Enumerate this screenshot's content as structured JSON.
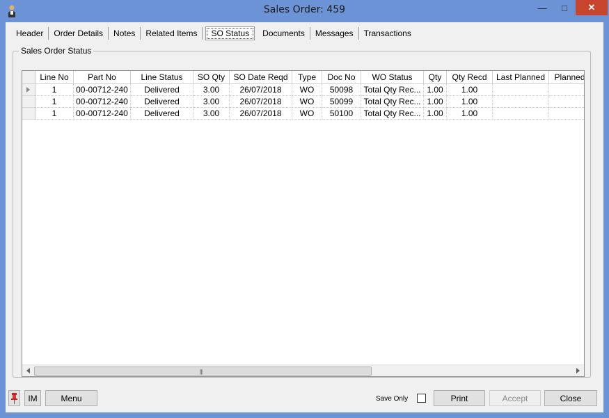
{
  "window": {
    "title": "Sales Order: 459"
  },
  "controls": {
    "minimize": "—",
    "maximize": "□",
    "close": "✕"
  },
  "tabs": [
    {
      "label": "Header"
    },
    {
      "label": "Order Details"
    },
    {
      "label": "Notes"
    },
    {
      "label": "Related Items"
    },
    {
      "label": "SO Status",
      "active": true
    },
    {
      "label": "Documents"
    },
    {
      "label": "Messages"
    },
    {
      "label": "Transactions"
    }
  ],
  "group": {
    "title": "Sales Order Status"
  },
  "grid": {
    "columns": [
      "Line No",
      "Part No",
      "Line Status",
      "SO Qty",
      "SO Date Reqd",
      "Type",
      "Doc No",
      "WO Status",
      "Qty",
      "Qty Recd",
      "Last Planned",
      "Planned"
    ],
    "rows": [
      [
        "1",
        "00-00712-240",
        "Delivered",
        "3.00",
        "26/07/2018",
        "WO",
        "50098",
        "Total Qty Rec...",
        "1.00",
        "1.00",
        "",
        ""
      ],
      [
        "1",
        "00-00712-240",
        "Delivered",
        "3.00",
        "26/07/2018",
        "WO",
        "50099",
        "Total Qty Rec...",
        "1.00",
        "1.00",
        "",
        ""
      ],
      [
        "1",
        "00-00712-240",
        "Delivered",
        "3.00",
        "26/07/2018",
        "WO",
        "50100",
        "Total Qty Rec...",
        "1.00",
        "1.00",
        "",
        ""
      ]
    ]
  },
  "footer": {
    "im_label": "IM",
    "menu_label": "Menu",
    "save_only_label": "Save Only",
    "print_label": "Print",
    "accept_label": "Accept",
    "close_label": "Close"
  }
}
